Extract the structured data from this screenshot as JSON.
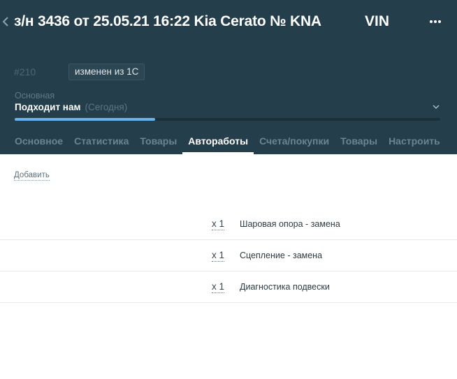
{
  "header": {
    "title": "з/н 3436 от 25.05.21 16:22 Kia Cerato № KNA",
    "vin_label": "VIN",
    "deal_id": "#210",
    "badge": "изменен из 1С",
    "funnel_label": "Основная",
    "stage_name": "Подходит нам",
    "stage_date": "(Сегодня)",
    "progress_fraction": 0.33
  },
  "tabs": [
    {
      "label": "Основное",
      "active": false
    },
    {
      "label": "Статистика",
      "active": false
    },
    {
      "label": "Товары",
      "active": false
    },
    {
      "label": "Автоработы",
      "active": true
    },
    {
      "label": "Счета/покупки",
      "active": false
    },
    {
      "label": "Товары",
      "active": false
    },
    {
      "label": "Настроить",
      "active": false
    }
  ],
  "content": {
    "add_label": "Добавить",
    "works": [
      {
        "qty": "x 1",
        "name": "Шаровая опора - замена"
      },
      {
        "qty": "x 1",
        "name": "Сцепление - замена"
      },
      {
        "qty": "x 1",
        "name": "Диагностика подвески"
      }
    ]
  },
  "colors": {
    "header_bg": "#243e4b",
    "progress_fill": "#6ab4ee",
    "active_tab": "#ffffff"
  },
  "icons": {
    "back": "chevron-left-icon",
    "more": "more-dots-icon",
    "stage": "chevron-down-icon"
  }
}
